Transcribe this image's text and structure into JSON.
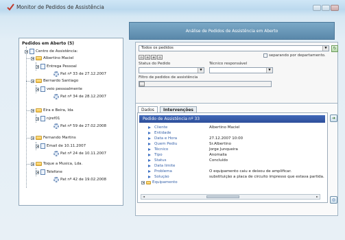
{
  "window": {
    "title": "Monitor de Pedidos de Assistência"
  },
  "banner": "Análise de Pedidos de Assistência em Aberto",
  "tree": {
    "header": "Pedidos em Aberto (5)",
    "root": "Centro de Assistência:",
    "clients": [
      {
        "name": "Albertino Maciel",
        "entity": "Entrega Pessoal",
        "ticket": "Pat nº 33 de 27.12.2007"
      },
      {
        "name": "Bernardo Santiago",
        "entity": "veio pessoalmente",
        "ticket": "Pat nº 34 de 28.12.2007"
      },
      {
        "name": "Eira e Beira, lda",
        "entity": "njref01",
        "ticket": "Pat nº 59 de 27.02.2008"
      },
      {
        "name": "Fernando Martins",
        "entity": "Email de 10.11.2007",
        "ticket": "Pat nº 24 de 10.11.2007"
      },
      {
        "name": "Toque a Musica, Lda.",
        "entity": "Telefone",
        "ticket": "Pat nº 42 de 19.02.2008"
      }
    ]
  },
  "filters": {
    "order_select": "Todos os pedidos",
    "split_checkbox_label": "separando por departamento.",
    "status_label": "Status do Pedido",
    "tech_label": "Técnico responsável",
    "filter_label": "Filtro de pedidos de assistência",
    "toolbar_btns": [
      "⊡",
      "⊞",
      "⊠",
      "⊟"
    ]
  },
  "tabs": [
    "Dados",
    "Intervenções"
  ],
  "record": {
    "header": "Pedido de Assistência nº 33",
    "fields": [
      {
        "label": "Cliente",
        "value": "Albertino Maciel"
      },
      {
        "label": "Entidade",
        "value": ""
      },
      {
        "label": "Data e Hora",
        "value": "27.12.2007 10:00"
      },
      {
        "label": "Quem Pediu",
        "value": "Sr.Albertino"
      },
      {
        "label": "Técnico",
        "value": "Jorge Junqueira"
      },
      {
        "label": "Tipo",
        "value": "Anomalia"
      },
      {
        "label": "Status",
        "value": "Concluído"
      },
      {
        "label": "Data limite",
        "value": ""
      },
      {
        "label": "Problema",
        "value": "O equipamento caiu e deixou de amplificar."
      },
      {
        "label": "Solução",
        "value": "substituição a placa de circuito impresso que estava partida."
      },
      {
        "label": "Equipamento",
        "value": ""
      }
    ]
  },
  "colors": {
    "accent": "#2e4f9a",
    "banner": "#5a88aa",
    "tree_link": "#3460a8"
  }
}
